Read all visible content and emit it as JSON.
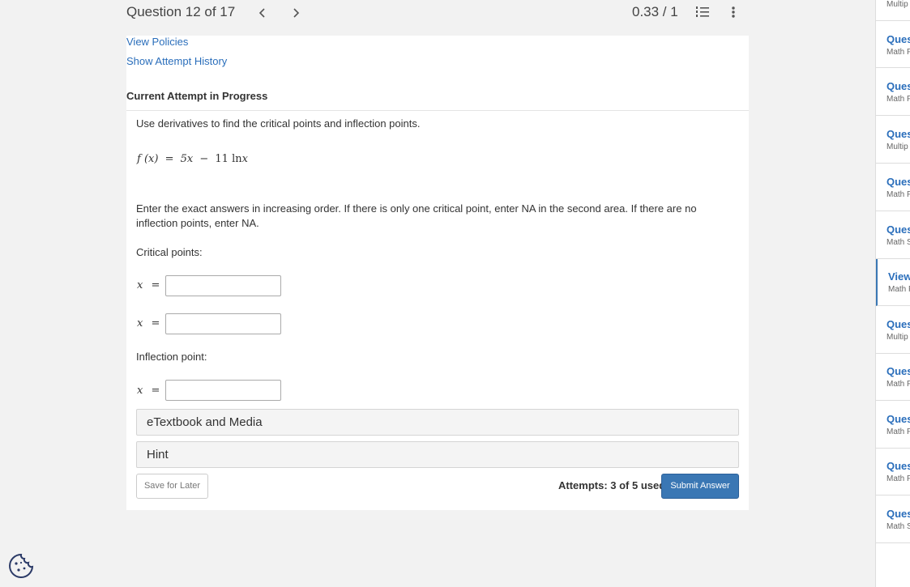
{
  "header": {
    "question_counter": "Question 12 of 17",
    "prev_icon": "chevron-left-icon",
    "next_icon": "chevron-right-icon",
    "score": "0.33 / 1",
    "list_icon": "numbered-list-icon",
    "menu_icon": "kebab-menu-icon"
  },
  "links": {
    "view_policies": "View Policies",
    "attempt_history": "Show Attempt History"
  },
  "attempt_heading": "Current Attempt in Progress",
  "question": {
    "prompt": "Use derivatives to find the critical points and inflection points.",
    "function_lhs": "f (x)",
    "function_eq": "=",
    "function_rhs_a": "5x",
    "function_minus": "−",
    "function_rhs_b": "11",
    "function_ln": "ln",
    "function_var": "x",
    "instructions": "Enter the exact answers in increasing order. If there is only one critical point, enter NA in the second area. If there are no inflection points, enter NA.",
    "critical_label": "Critical points:",
    "inflection_label": "Inflection point:",
    "x_var": "x",
    "x_eq": "=",
    "critical_1_value": "",
    "critical_2_value": "",
    "inflection_value": ""
  },
  "accordions": {
    "etextbook": "eTextbook and Media",
    "hint": "Hint"
  },
  "footer": {
    "save_label": "Save for Later",
    "attempts_text": "Attempts: 3 of 5 used",
    "submit_label": "Submit Answer"
  },
  "sidebar": {
    "top_partial": "Multip",
    "items": [
      {
        "title": "Ques",
        "sub": "Math F"
      },
      {
        "title": "Ques",
        "sub": "Math F"
      },
      {
        "title": "Ques",
        "sub": "Multip"
      },
      {
        "title": "Ques",
        "sub": "Math F"
      },
      {
        "title": "Ques",
        "sub": "Math S"
      },
      {
        "title": "View",
        "sub": "Math F"
      },
      {
        "title": "Ques",
        "sub": "Multip"
      },
      {
        "title": "Ques",
        "sub": "Math F"
      },
      {
        "title": "Ques",
        "sub": "Math F"
      },
      {
        "title": "Ques",
        "sub": "Math F"
      },
      {
        "title": "Ques",
        "sub": "Math S"
      }
    ]
  },
  "cookie_icon": "cookie-icon",
  "colors": {
    "accent": "#3a77b4",
    "link": "#2a6ebb",
    "background": "#f2f2f2"
  }
}
